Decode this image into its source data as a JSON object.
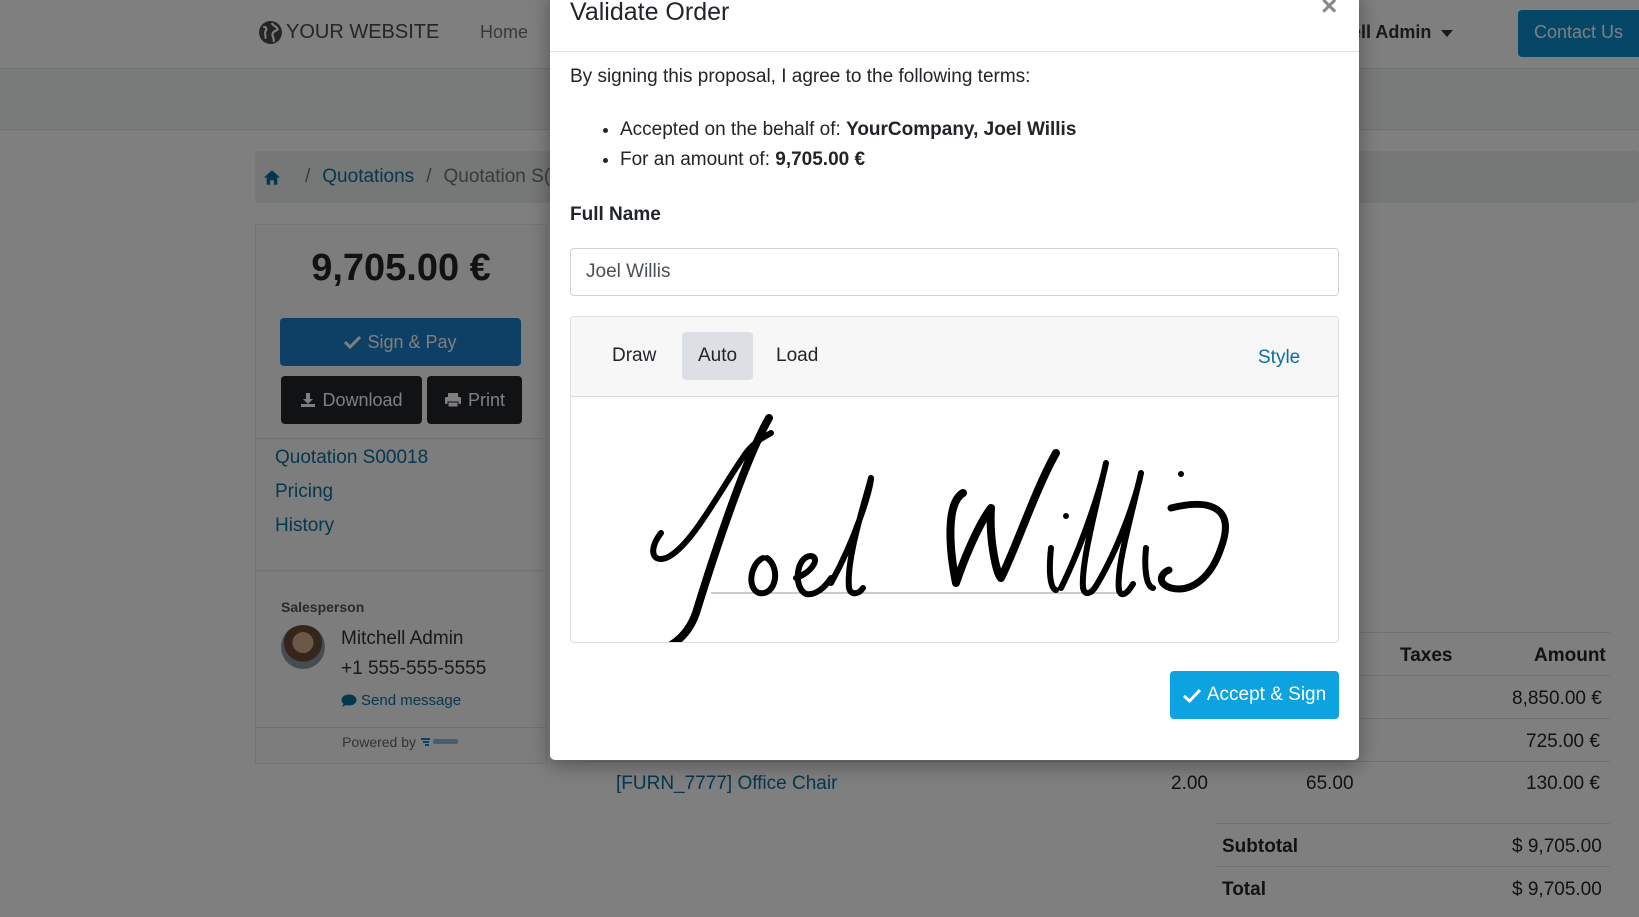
{
  "navbar": {
    "brand": "YOUR WEBSITE",
    "home": "Home",
    "user": "hell Admin",
    "contact": "Contact Us"
  },
  "breadcrumb": {
    "link": "Quotations",
    "current": "Quotation S("
  },
  "sidebar": {
    "amount": "9,705.00 €",
    "sign_pay": "Sign & Pay",
    "download": "Download",
    "print": "Print",
    "toc": [
      "Quotation S00018",
      "Pricing",
      "History"
    ],
    "salesperson_label": "Salesperson",
    "salesperson_name": "Mitchell Admin",
    "salesperson_phone": "+1 555-555-5555",
    "send_message": "Send message",
    "powered_by": "Powered by"
  },
  "table": {
    "headers": {
      "taxes": "Taxes",
      "amount": "Amount"
    },
    "rows": [
      {
        "product": "",
        "qty": "",
        "price": "",
        "amount": "8,850.00 €"
      },
      {
        "product": "",
        "qty": "",
        "price": "",
        "amount": "725.00 €"
      },
      {
        "product": "[FURN_7777] Office Chair",
        "qty": "2.00",
        "price": "65.00",
        "amount": "130.00 €"
      }
    ],
    "subtotal_label": "Subtotal",
    "subtotal_value": "$ 9,705.00",
    "total_label": "Total",
    "total_value": "$ 9,705.00"
  },
  "modal": {
    "title": "Validate Order",
    "close": "×",
    "terms_intro": "By signing this proposal, I agree to the following terms:",
    "behalf_label": "Accepted on the behalf of:",
    "behalf_value": "YourCompany, Joel Willis",
    "amount_label": "For an amount of:",
    "amount_value": "9,705.00 €",
    "full_name_label": "Full Name",
    "full_name_value": "Joel Willis",
    "tabs": [
      "Draw",
      "Auto",
      "Load"
    ],
    "active_tab": "Auto",
    "style_link": "Style",
    "signature_text": "Joel Willis",
    "accept_button": "Accept & Sign"
  },
  "colors": {
    "primary": "#1b80c8",
    "accept": "#0ca3e0",
    "link": "#0a6e9e",
    "dark_button": "#212529"
  }
}
